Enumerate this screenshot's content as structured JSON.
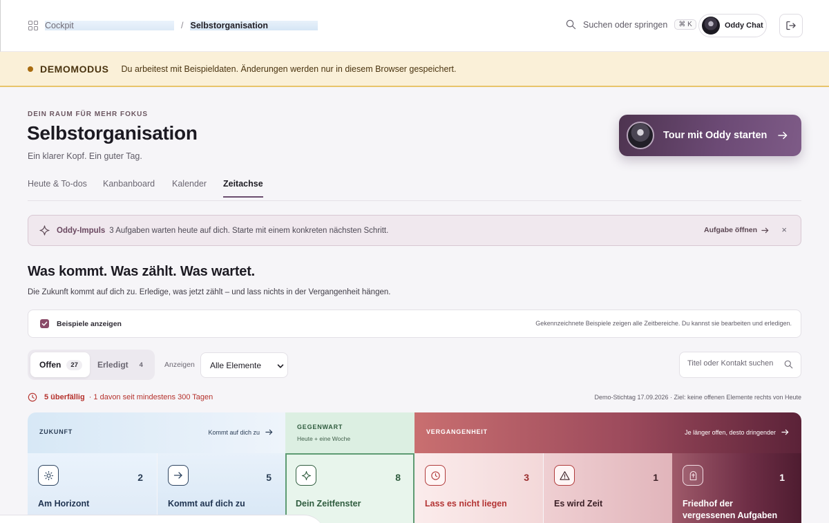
{
  "header": {
    "breadcrumb": {
      "root": "Cockpit",
      "separator": "/",
      "current": "Selbstorganisation"
    },
    "search": {
      "label": "Suchen oder springen",
      "shortcut": "⌘ K"
    },
    "chat_button": "Oddy Chat",
    "icons": {
      "grid": "grid-icon",
      "search": "search-icon",
      "logout": "logout-icon"
    }
  },
  "demo_banner": {
    "title": "DEMOMODUS",
    "text": "Du arbeitest mit Beispieldaten. Änderungen werden nur in diesem Browser gespeichert."
  },
  "hero": {
    "eyebrow": "DEIN RAUM FÜR MEHR FOKUS",
    "title": "Selbstorganisation",
    "subtitle": "Ein klarer Kopf. Ein guter Tag.",
    "tour_button": "Tour mit Oddy starten"
  },
  "tabs": [
    {
      "label": "Heute & To-dos",
      "active": false
    },
    {
      "label": "Kanbanboard",
      "active": false
    },
    {
      "label": "Kalender",
      "active": false
    },
    {
      "label": "Zeitachse",
      "active": true
    }
  ],
  "impulse": {
    "label": "Oddy-Impuls",
    "text": "3 Aufgaben warten heute auf dich. Starte mit einem konkreten nächsten Schritt.",
    "action": "Aufgabe öffnen",
    "close": "×"
  },
  "section": {
    "title": "Was kommt. Was zählt. Was wartet.",
    "subtitle": "Die Zukunft kommt auf dich zu. Erledige, was jetzt zählt – und lass nichts in der Vergangenheit hängen."
  },
  "examples": {
    "label": "Beispiele anzeigen",
    "checked": true,
    "hint": "Gekennzeichnete Beispiele zeigen alle Zeitbereiche. Du kannst sie bearbeiten und erledigen."
  },
  "filters": {
    "segments": [
      {
        "label": "Offen",
        "count": "27",
        "active": true
      },
      {
        "label": "Erledigt",
        "count": "4",
        "active": false
      }
    ],
    "show_label": "Anzeigen",
    "select_value": "Alle Elemente",
    "search_placeholder": "Titel oder Kontakt suchen"
  },
  "overdue": {
    "bold": "5 überfällig",
    "rest": "· 1 davon seit mindestens 300 Tagen"
  },
  "stichtag": "Demo-Stichtag 17.09.2026 · Ziel: keine offenen Elemente rechts von Heute",
  "timeline": {
    "zones": {
      "zukunft": {
        "title": "ZUKUNFT",
        "hint": "Kommt auf dich zu"
      },
      "gegenwart": {
        "title": "GEGENWART",
        "sub": "Heute + eine Woche"
      },
      "vergangenheit": {
        "title": "VERGANGENHEIT",
        "hint": "Je länger offen, desto dringender"
      }
    },
    "cards": [
      {
        "label": "Am Horizont",
        "count": "2",
        "icon": "sun-icon"
      },
      {
        "label": "Kommt auf dich zu",
        "count": "5",
        "icon": "arrow-right-icon"
      },
      {
        "label": "Dein Zeitfenster",
        "count": "8",
        "icon": "sparkle-icon"
      },
      {
        "label": "Lass es nicht liegen",
        "count": "3",
        "icon": "clock-icon"
      },
      {
        "label": "Es wird Zeit",
        "count": "1",
        "icon": "warning-icon"
      },
      {
        "label": "Friedhof der vergessenen Aufgaben",
        "count": "1",
        "icon": "tombstone-icon"
      }
    ]
  },
  "colors": {
    "banner_bg": "#faf0d8",
    "accent": "#6b4d6e",
    "overdue": "#b5312c",
    "zukunft": "#d7e8f6",
    "gegenwart": "#dcefe2",
    "vergangenheit": "#9c4a5c"
  }
}
